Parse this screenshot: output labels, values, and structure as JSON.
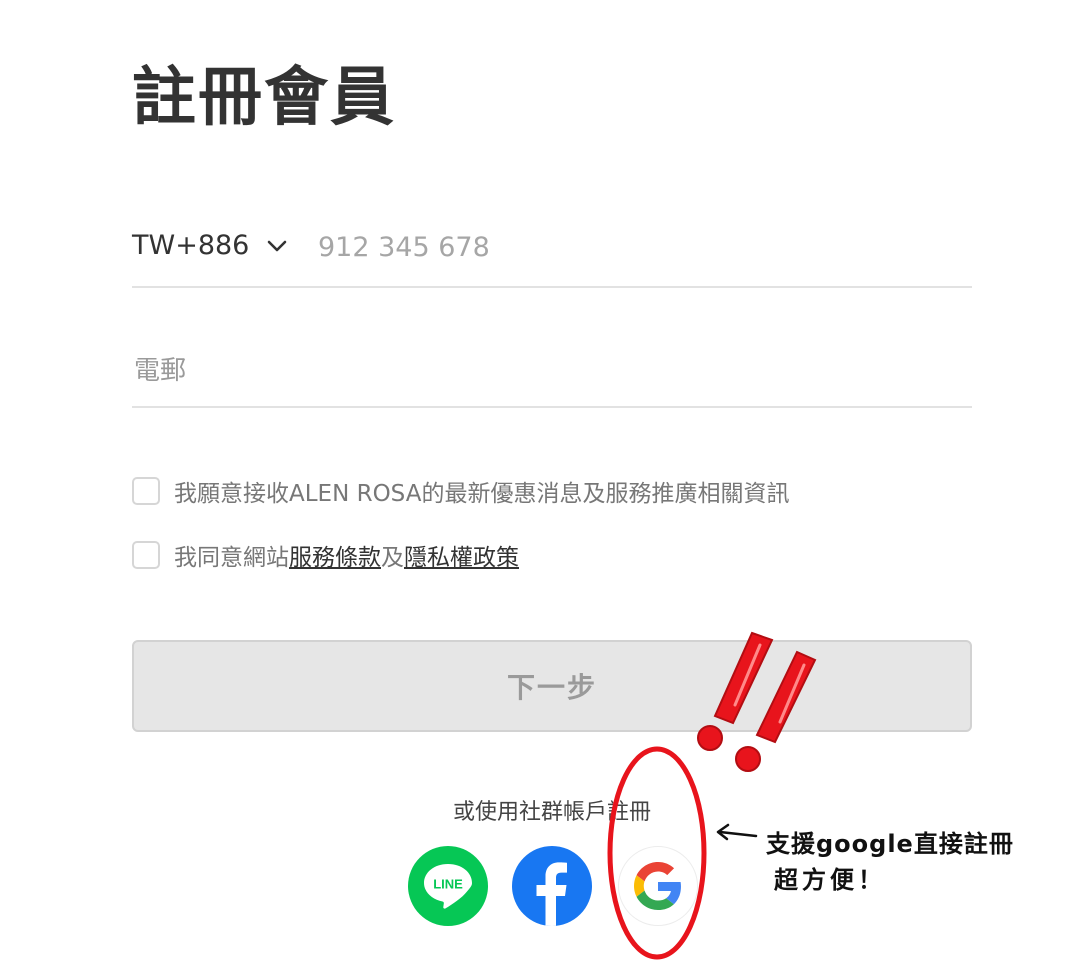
{
  "page_title": "註冊會員",
  "phone": {
    "country_code": "TW+886",
    "placeholder": "912 345 678",
    "value": ""
  },
  "email": {
    "placeholder": "電郵",
    "value": ""
  },
  "consent": {
    "marketing_label": "我願意接收ALEN ROSA的最新優惠消息及服務推廣相關資訊",
    "terms_prefix": "我同意網站",
    "terms_link": "服務條款",
    "terms_joiner": "及",
    "privacy_link": "隱私權政策",
    "marketing_checked": false,
    "terms_checked": false
  },
  "next_button": {
    "label": "下一步",
    "enabled": false
  },
  "social": {
    "caption": "或使用社群帳戶註冊",
    "providers": [
      {
        "name": "LINE",
        "label": "LINE",
        "color": "#06c755"
      },
      {
        "name": "Facebook",
        "color": "#1877f2"
      },
      {
        "name": "Google",
        "color": "#ffffff"
      }
    ]
  },
  "annotation": {
    "arrow": "⟵",
    "line1": "支援google直接註冊",
    "line2": "超方便！",
    "highlight_color": "#e8141c"
  }
}
